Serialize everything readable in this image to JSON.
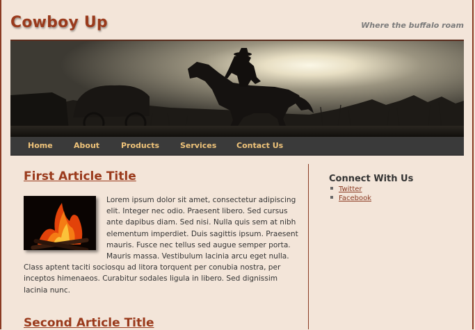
{
  "site": {
    "title": "Cowboy Up",
    "tagline": "Where the buffalo roam"
  },
  "nav": {
    "items": [
      "Home",
      "About",
      "Products",
      "Services",
      "Contact Us"
    ]
  },
  "articles": [
    {
      "title": "First Article Title",
      "body": "Lorem ipsum dolor sit amet, consectetur adipiscing elit. Integer nec odio. Praesent libero. Sed cursus ante dapibus diam. Sed nisi. Nulla quis sem at nibh elementum imperdiet. Duis sagittis ipsum. Praesent mauris. Fusce nec tellus sed augue semper porta. Mauris massa. Vestibulum lacinia arcu eget nulla. Class aptent taciti sociosqu ad litora torquent per conubia nostra, per inceptos himenaeos. Curabitur sodales ligula in libero. Sed dignissim lacinia nunc."
    },
    {
      "title": "Second Article Title"
    }
  ],
  "sidebar": {
    "title": "Connect With Us",
    "links": [
      "Twitter",
      "Facebook"
    ]
  },
  "colors": {
    "background": "#f3e5d9",
    "accent": "#9a3a1c",
    "nav_bg": "#3a3a3a",
    "nav_text": "#f0c47a"
  }
}
